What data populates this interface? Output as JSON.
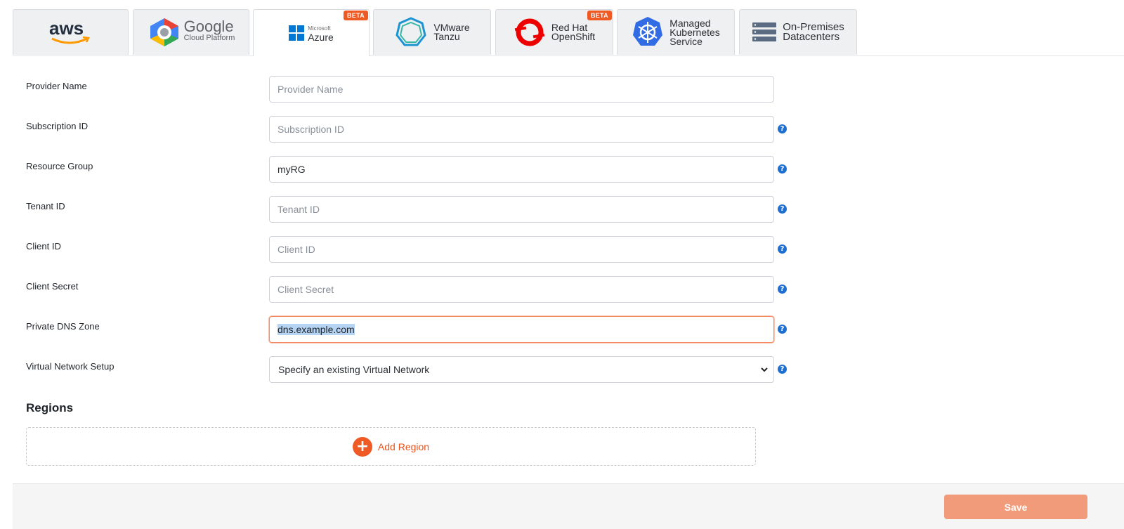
{
  "tabs": [
    {
      "id": "aws",
      "label": "aws",
      "badge": ""
    },
    {
      "id": "gcp",
      "label": "Google",
      "sublabel": "Cloud Platform",
      "badge": ""
    },
    {
      "id": "azure",
      "label": "Azure",
      "sublabel": "Microsoft",
      "badge": "BETA",
      "active": true
    },
    {
      "id": "tanzu",
      "label_line1": "VMware",
      "label_line2": "Tanzu",
      "badge": ""
    },
    {
      "id": "openshift",
      "label_line1": "Red Hat",
      "label_line2": "OpenShift",
      "badge": "BETA"
    },
    {
      "id": "mks",
      "label_line1": "Managed",
      "label_line2": "Kubernetes",
      "label_line3": "Service",
      "badge": ""
    },
    {
      "id": "onprem",
      "label_line1": "On-Premises",
      "label_line2": "Datacenters",
      "badge": ""
    }
  ],
  "form": {
    "provider_name": {
      "label": "Provider Name",
      "value": "",
      "placeholder": "Provider Name"
    },
    "subscription_id": {
      "label": "Subscription ID",
      "value": "",
      "placeholder": "Subscription ID"
    },
    "resource_group": {
      "label": "Resource Group",
      "value": "myRG",
      "placeholder": ""
    },
    "tenant_id": {
      "label": "Tenant ID",
      "value": "",
      "placeholder": "Tenant ID"
    },
    "client_id": {
      "label": "Client ID",
      "value": "",
      "placeholder": "Client ID"
    },
    "client_secret": {
      "label": "Client Secret",
      "value": "",
      "placeholder": "Client Secret"
    },
    "private_dns_zone": {
      "label": "Private DNS Zone",
      "value": "dns.example.com",
      "placeholder": ""
    },
    "virtual_network_setup": {
      "label": "Virtual Network Setup",
      "value": "Specify an existing Virtual Network"
    }
  },
  "help_glyph": "?",
  "regions": {
    "title": "Regions",
    "add_label": "Add Region",
    "plus_glyph": "+"
  },
  "footer": {
    "save_label": "Save"
  },
  "colors": {
    "accent": "#ef5a24",
    "help": "#1f6fd0",
    "save_bg": "#f19b7a"
  }
}
